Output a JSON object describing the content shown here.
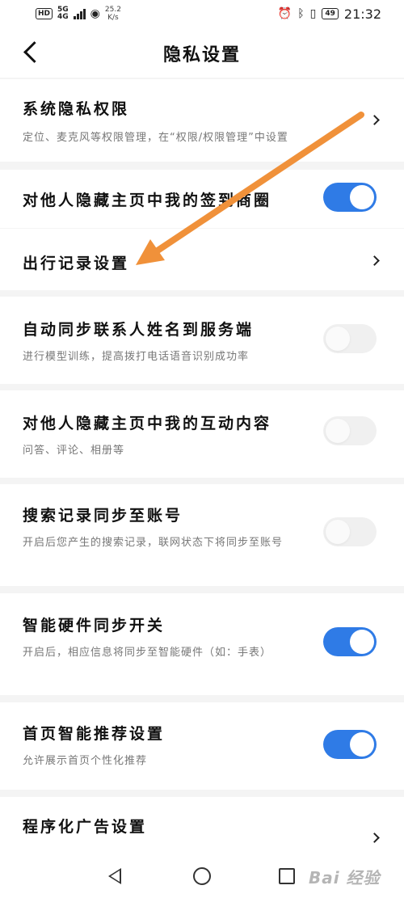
{
  "status_bar": {
    "network_badge": "HD",
    "signal_type": "5G",
    "signal_sub": "4G",
    "speed_value": "25.2",
    "speed_unit": "K/s",
    "battery": "49",
    "time": "21:32"
  },
  "header": {
    "title": "隐私设置"
  },
  "rows": [
    {
      "label": "系统隐私权限",
      "desc": "定位、麦克风等权限管理，在“权限/权限管理”中设置",
      "control": "chevron"
    },
    {
      "label": "对他人隐藏主页中我的签到商圈",
      "control": "toggle",
      "on": true
    },
    {
      "label": "出行记录设置",
      "control": "chevron"
    },
    {
      "label": "自动同步联系人姓名到服务端",
      "desc": "进行模型训练，提高拨打电话语音识别成功率",
      "control": "toggle",
      "on": false
    },
    {
      "label": "对他人隐藏主页中我的互动内容",
      "desc": "问答、评论、相册等",
      "control": "toggle",
      "on": false
    },
    {
      "label": "搜索记录同步至账号",
      "desc": "开启后您产生的搜索记录，联网状态下将同步至账号",
      "control": "toggle",
      "on": false
    },
    {
      "label": "智能硬件同步开关",
      "desc": "开启后，相应信息将同步至智能硬件（如：手表）",
      "control": "toggle",
      "on": true
    },
    {
      "label": "首页智能推荐设置",
      "desc": "允许展示首页个性化推荐",
      "control": "toggle",
      "on": true
    },
    {
      "label": "程序化广告设置",
      "control": "chevron"
    }
  ],
  "watermark": "Bai 经验",
  "colors": {
    "accent": "#2f7be6",
    "annotation_arrow": "#f0913a"
  }
}
